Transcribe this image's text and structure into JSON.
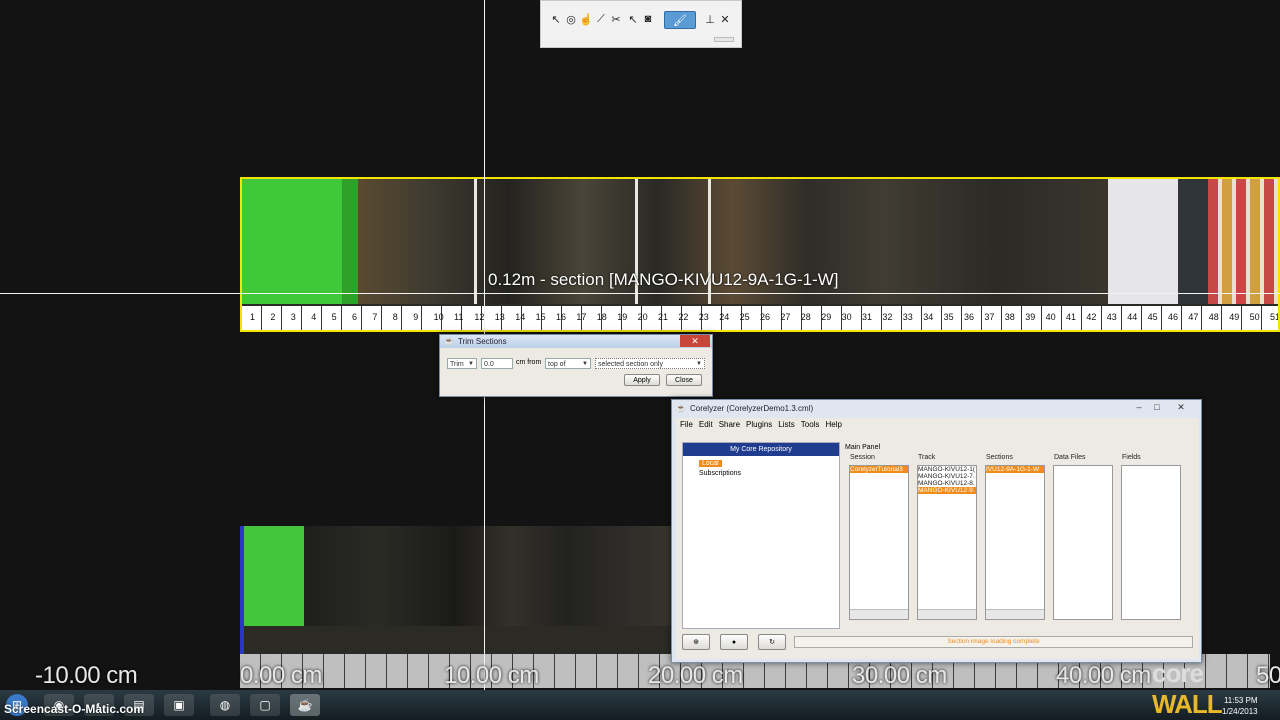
{
  "palette": {
    "tools": [
      "select-arrow",
      "target",
      "hand-pointer",
      "line",
      "cut",
      "pointer",
      "snapshot",
      "paintbrush",
      "anchor",
      "close"
    ]
  },
  "core_view": {
    "section_label": "0.12m - section [MANGO-KIVU12-9A-1G-1-W]",
    "ruler_top_numbers": [
      "1",
      "2",
      "3",
      "4",
      "5",
      "6",
      "7",
      "8",
      "9",
      "10",
      "11",
      "12",
      "13",
      "14",
      "15",
      "16",
      "17",
      "18",
      "19",
      "20",
      "21",
      "22",
      "23",
      "24",
      "25",
      "26",
      "27",
      "28",
      "29",
      "30",
      "31",
      "32",
      "33",
      "34",
      "35",
      "36",
      "37",
      "38",
      "39",
      "40",
      "41",
      "42",
      "43",
      "44",
      "45",
      "46",
      "47",
      "48",
      "49",
      "50",
      "51"
    ],
    "axis_labels": [
      "-10.00 cm",
      "0.00 cm",
      "10.00 cm",
      "20.00 cm",
      "30.00 cm",
      "40.00 cm",
      "50"
    ]
  },
  "trim_dialog": {
    "title": "Trim Sections",
    "mode": "Trim",
    "amount": "0.0",
    "unit_label": "cm from",
    "position": "top of",
    "scope": "selected section only",
    "apply_label": "Apply",
    "close_label": "Close"
  },
  "corelyzer": {
    "title": "Corelyzer (CorelyzerDemo1.3.cml)",
    "menu": [
      "File",
      "Edit",
      "Share",
      "Plugins",
      "Lists",
      "Tools",
      "Help"
    ],
    "repo_header": "My Core Repository",
    "repo_items": [
      "Local",
      "Subscriptions"
    ],
    "main_panel_label": "Main Panel",
    "columns": {
      "session": {
        "header": "Session",
        "items": [
          "CorelyzerTutorial3"
        ]
      },
      "track": {
        "header": "Track",
        "items": [
          "MANGO-KIVU12-1(",
          "MANGO-KIVU12-7.",
          "MANGO-KIVU12-8.",
          "MANGO-KIVU12-9."
        ]
      },
      "sections": {
        "header": "Sections",
        "items": [
          "IVU12-9A-1G-1-W"
        ]
      },
      "data_files": {
        "header": "Data Files",
        "items": []
      },
      "fields": {
        "header": "Fields",
        "items": []
      }
    },
    "status": "Section image loading complete"
  },
  "overlay": {
    "watermark": "Screencast-O-Matic.com",
    "logo_a": "core",
    "logo_b": "WALL"
  },
  "taskbar": {
    "time": "11:53 PM",
    "date": "1/24/2013"
  },
  "colors": {
    "selection_yellow": "#f2e500",
    "orange_selection": "#f08c1c",
    "repo_header_blue": "#203c8e"
  }
}
